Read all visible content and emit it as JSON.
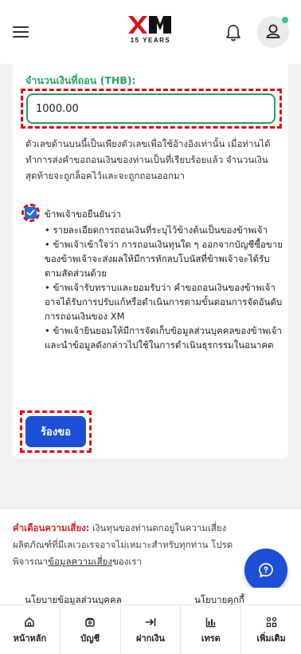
{
  "header": {
    "logo_subtitle": "15 YEARS",
    "icons": [
      "menu-icon",
      "xm-logo",
      "bell-icon",
      "user-icon"
    ],
    "notification_dot_color": "#3cc58a"
  },
  "form": {
    "amount_label": "จำนวนเงินที่ถอน (THB):",
    "amount_value": "1000.00",
    "note": "ตัวเลขด้านบนนี้เป็นเพียงตัวเลขเพื่อใช้อ้างอิงเท่านั้น เมื่อท่านได้ทำการส่งคำขอถอนเงินของท่านเป็นที่เรียบร้อยแล้ว จำนวนเงินสุดท้ายจะถูกล็อคไว้และจะถูกถอนออกมา",
    "confirm_checked": true,
    "confirm_title": "ข้าพเจ้าขอยืนยันว่า",
    "confirm_items": [
      "• รายละเอียดการถอนเงินที่ระบุไว้ข้างต้นเป็นของข้าพเจ้า",
      "• ข้าพเจ้าเข้าใจว่า การถอนเงินทุนใด ๆ ออกจากบัญชีซื้อขายของข้าพเจ้าจะส่งผลให้มีการหักลบโบนัสที่ข้าพเจ้าจะได้รับตามสัดส่วนด้วย",
      "• ข้าพเจ้ารับทราบและยอมรับว่า คำขอถอนเงินของข้าพเจ้าอาจได้รับการปรับแก้หรือดำเนินการตามขั้นตอนการจัดอันดับการถอนเงินของ XM",
      "• ข้าพเจ้ายินยอมให้มีการจัดเก็บข้อมูลส่วนบุคคลของข้าพเจ้าและนำข้อมูลดังกล่าวไปใช้ในการดำเนินธุรกรรมในอนาคต"
    ],
    "submit_label": "ร้องขอ",
    "accent_color": "#2aa266",
    "button_color": "#1c4fd6",
    "highlight_color": "#e10010"
  },
  "risk": {
    "title": "คำเตือนความเสี่ยง:",
    "text": " เงินทุนของท่านตกอยู่ในความเสี่ยง ผลิตภัณฑ์ที่มีเลเวอเรจอาจไม่เหมาะสำหรับทุกท่าน โปรดพิจารณา",
    "link": "ข้อมูลความเสี่ยง",
    "suffix": "ของเรา"
  },
  "footer": {
    "privacy_policy": "นโยบายข้อมูลส่วนบุคคล",
    "cookie_policy": "นโยบายคุกกี้"
  },
  "nav": [
    {
      "label": "หน้าหลัก",
      "icon": "home-icon"
    },
    {
      "label": "บัญชี",
      "icon": "wallet-icon"
    },
    {
      "label": "ฝากเงิน",
      "icon": "deposit-icon"
    },
    {
      "label": "เทรด",
      "icon": "chart-icon"
    },
    {
      "label": "เพิ่มเติม",
      "icon": "grid-icon"
    }
  ]
}
